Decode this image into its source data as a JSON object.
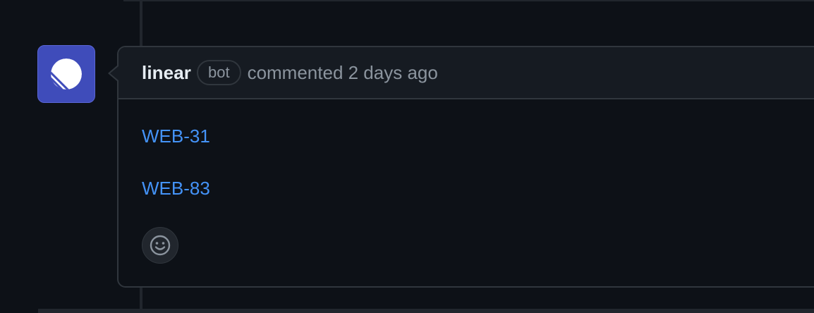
{
  "comment": {
    "author": "linear",
    "badge": "bot",
    "action_text": "commented 2 days ago",
    "links": [
      {
        "label": "WEB-31"
      },
      {
        "label": "WEB-83"
      }
    ]
  },
  "icons": {
    "avatar": "linear-logo-icon",
    "reaction": "smiley-icon"
  },
  "colors": {
    "background": "#0d1117",
    "header_bg": "#161b22",
    "border": "#30363d",
    "link": "#4493f8",
    "author": "#e6edf3",
    "muted": "#8b949e",
    "avatar_bg": "#3f4cba"
  }
}
